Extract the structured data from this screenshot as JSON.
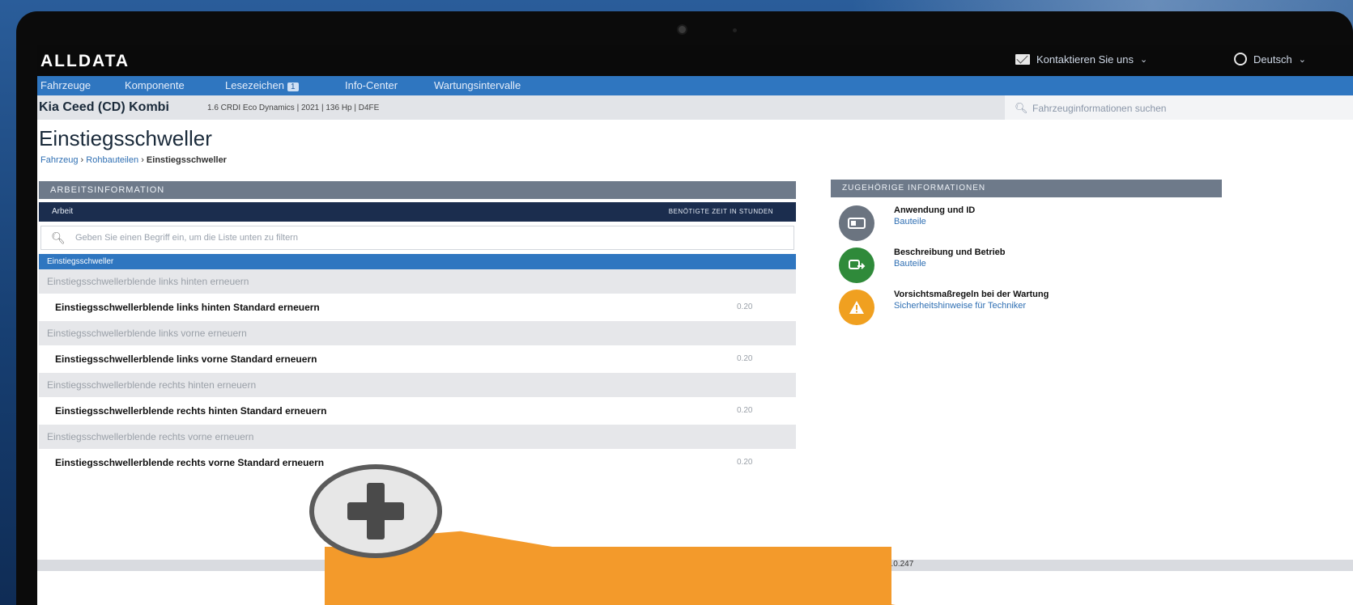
{
  "app": {
    "logo": "ALLDATA"
  },
  "topbar": {
    "contact_label": "Kontaktieren Sie uns",
    "language_label": "Deutsch"
  },
  "nav": {
    "tabs": [
      "Fahrzeuge",
      "Komponente",
      "Lesezeichen",
      "Info-Center",
      "Wartungsintervalle"
    ],
    "bookmark_count": "1"
  },
  "vehicle": {
    "name": "Kia Ceed (CD) Kombi",
    "detail": "1.6 CRDI Eco Dynamics | 2021 | 136 Hp | D4FE"
  },
  "search": {
    "placeholder": "Fahrzeuginformationen suchen"
  },
  "page": {
    "title": "Einstiegsschweller"
  },
  "breadcrumb": {
    "items": [
      "Fahrzeug",
      "Rohbauteilen",
      "Einstiegsschweller"
    ],
    "separator": "›"
  },
  "work_info": {
    "header": "ARBEITSINFORMATION",
    "column_work": "Arbeit",
    "column_time": "BENÖTIGTE ZEIT IN STUNDEN",
    "filter_placeholder": "Geben Sie einen Begriff ein, um die Liste unten zu filtern",
    "section": "Einstiegsschweller",
    "groups": [
      {
        "group": "Einstiegsschwellerblende links hinten erneuern",
        "item": "Einstiegsschwellerblende links hinten Standard erneuern",
        "time": "0.20"
      },
      {
        "group": "Einstiegsschwellerblende links vorne erneuern",
        "item": "Einstiegsschwellerblende links vorne Standard erneuern",
        "time": "0.20"
      },
      {
        "group": "Einstiegsschwellerblende rechts hinten erneuern",
        "item": "Einstiegsschwellerblende rechts hinten Standard erneuern",
        "time": "0.20"
      },
      {
        "group": "Einstiegsschwellerblende rechts vorne erneuern",
        "item": "Einstiegsschwellerblende rechts vorne Standard erneuern",
        "time": "0.20"
      }
    ]
  },
  "related": {
    "header": "ZUGEHÖRIGE INFORMATIONEN",
    "items": [
      {
        "title": "Anwendung und ID",
        "sub": "Bauteile",
        "color": "#6b7480",
        "icon": "id-card-icon"
      },
      {
        "title": "Beschreibung und Betrieb",
        "sub": "Bauteile",
        "color": "#2f8a3a",
        "icon": "gear-car-icon"
      },
      {
        "title": "Vorsichtsmaßregeln bei der Wartung",
        "sub": "Sicherheitshinweise für Techniker",
        "color": "#f0a020",
        "icon": "warning-icon"
      }
    ]
  },
  "footer": {
    "version": "Version: 1.0.247"
  },
  "colors": {
    "accent": "#2f76c0",
    "navy": "#1b2d4e",
    "orange": "#f39a2b"
  }
}
